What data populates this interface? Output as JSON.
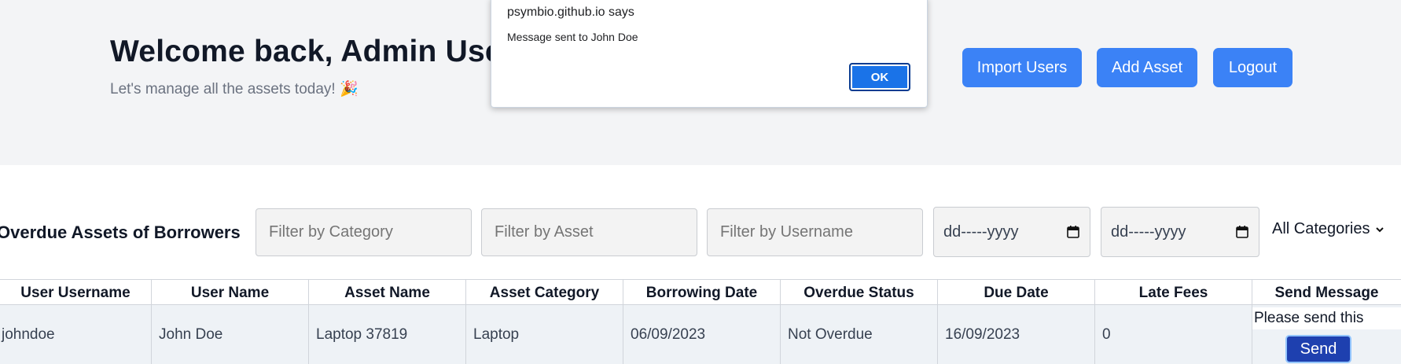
{
  "header": {
    "welcome": "Welcome back, Admin User",
    "subtitle": "Let's manage all the assets today! 🎉",
    "buttons": {
      "import_users": "Import Users",
      "add_asset": "Add Asset",
      "logout": "Logout"
    }
  },
  "section": {
    "title": "Overdue Assets of Borrowers",
    "filters": {
      "category_placeholder": "Filter by Category",
      "asset_placeholder": "Filter by Asset",
      "username_placeholder": "Filter by Username",
      "start_date": "dd-----yyyy",
      "end_date": "dd-----yyyy",
      "category_select": "All Categories"
    }
  },
  "table": {
    "columns": [
      "User Username",
      "User Name",
      "Asset Name",
      "Asset Category",
      "Borrowing Date",
      "Overdue Status",
      "Due Date",
      "Late Fees",
      "Send Message"
    ],
    "rows": [
      {
        "username": "johndoe",
        "name": "John Doe",
        "asset_name": "Laptop 37819",
        "asset_category": "Laptop",
        "borrowing_date": "06/09/2023",
        "overdue_status": "Not Overdue",
        "due_date": "16/09/2023",
        "late_fees": "0",
        "message_value": "Please send this",
        "send_label": "Send"
      }
    ]
  },
  "dialog": {
    "title": "psymbio.github.io says",
    "message": "Message sent to John Doe",
    "ok_label": "OK"
  },
  "colors": {
    "primary": "#3b82f6",
    "send_button": "#1e40af",
    "header_bg": "#f3f4f6",
    "dialog_ok": "#1a73e8"
  }
}
